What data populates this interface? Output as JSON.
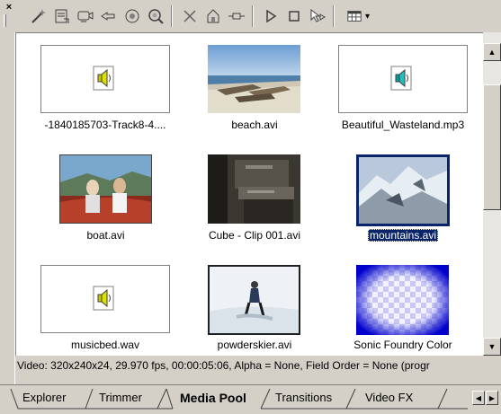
{
  "toolbar": {
    "icons": [
      "close-small-icon",
      "magic-wand-icon",
      "import-media-icon",
      "capture-icon",
      "get-media-icon",
      "media-fx-icon",
      "search-media-icon",
      "delete-icon",
      "properties-icon",
      "plugin-icon",
      "play-icon",
      "stop-icon",
      "auto-preview-icon",
      "views-icon"
    ],
    "views_arrow": "▾"
  },
  "media": [
    {
      "name": "-1840185703-Track8-4....",
      "kind": "audio"
    },
    {
      "name": "beach.avi",
      "kind": "video"
    },
    {
      "name": "Beautiful_Wasteland.mp3",
      "kind": "audio"
    },
    {
      "name": "boat.avi",
      "kind": "video"
    },
    {
      "name": "Cube - Clip 001.avi",
      "kind": "video"
    },
    {
      "name": "mountains.avi",
      "kind": "video",
      "selected": true
    },
    {
      "name": "musicbed.wav",
      "kind": "audio"
    },
    {
      "name": "powderskier.avi",
      "kind": "video"
    },
    {
      "name": "Sonic Foundry Color",
      "kind": "generated"
    }
  ],
  "status_text": "Video: 320x240x24, 29.970 fps, 00:00:05:06, Alpha = None, Field Order = None (progr",
  "tabs": [
    {
      "label": "Explorer",
      "active": false
    },
    {
      "label": "Trimmer",
      "active": false
    },
    {
      "label": "Media Pool",
      "active": true
    },
    {
      "label": "Transitions",
      "active": false
    },
    {
      "label": "Video FX",
      "active": false
    }
  ],
  "scrollbar": {
    "up": "▲",
    "down": "▼"
  },
  "tab_nav": {
    "prev": "◀",
    "next": "▶"
  }
}
